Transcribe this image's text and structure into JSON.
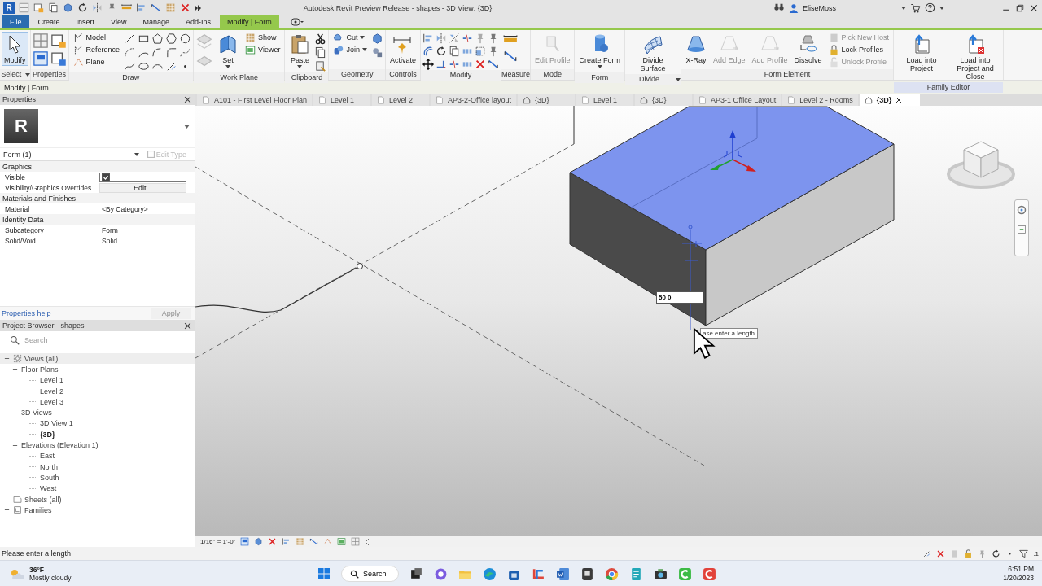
{
  "window": {
    "logo": "R",
    "title": "Autodesk Revit Preview Release - shapes - 3D View: {3D}",
    "user": "EliseMoss"
  },
  "ribbon_tabs": [
    {
      "label": "File",
      "kind": "file",
      "selected": false
    },
    {
      "label": "Create",
      "kind": "tab",
      "selected": false
    },
    {
      "label": "Insert",
      "kind": "tab",
      "selected": false
    },
    {
      "label": "View",
      "kind": "tab",
      "selected": false
    },
    {
      "label": "Manage",
      "kind": "tab",
      "selected": false
    },
    {
      "label": "Add-Ins",
      "kind": "tab",
      "selected": false
    },
    {
      "label": "Modify | Form",
      "kind": "context",
      "selected": true
    }
  ],
  "ribbon_panels": [
    {
      "title": "Select",
      "menu": true,
      "highlighted": false,
      "tools": [
        {
          "kind": "large",
          "label": "Modify",
          "active": true,
          "disabled": false,
          "dropdown": false
        }
      ]
    },
    {
      "title": "Properties",
      "menu": false,
      "highlighted": false,
      "tools": [
        {
          "kind": "propertyicons"
        }
      ]
    },
    {
      "title": "Draw",
      "menu": false,
      "highlighted": false,
      "tools": [
        {
          "kind": "small",
          "label": "Model",
          "active": false,
          "disabled": false,
          "dropdown": false
        },
        {
          "kind": "small",
          "label": "Reference",
          "active": false,
          "disabled": false,
          "dropdown": false
        },
        {
          "kind": "small",
          "label": "Plane",
          "active": false,
          "disabled": false,
          "dropdown": false
        },
        {
          "kind": "drawshapes"
        }
      ]
    },
    {
      "title": "Work Plane",
      "menu": false,
      "highlighted": false,
      "tools": [
        {
          "kind": "planeicons"
        },
        {
          "kind": "large",
          "label": "Set",
          "active": false,
          "disabled": false,
          "dropdown": true
        },
        {
          "kind": "small",
          "label": "Show",
          "active": false,
          "disabled": false,
          "dropdown": false
        },
        {
          "kind": "small",
          "label": "Viewer",
          "active": false,
          "disabled": false,
          "dropdown": false
        }
      ]
    },
    {
      "title": "Clipboard",
      "menu": false,
      "highlighted": false,
      "tools": [
        {
          "kind": "large",
          "label": "Paste",
          "active": false,
          "disabled": false,
          "dropdown": true
        },
        {
          "kind": "clipicons"
        }
      ]
    },
    {
      "title": "Geometry",
      "menu": false,
      "highlighted": false,
      "tools": [
        {
          "kind": "small",
          "label": "Cut",
          "active": false,
          "disabled": false,
          "dropdown": true
        },
        {
          "kind": "small",
          "label": "Join",
          "active": false,
          "disabled": false,
          "dropdown": true
        },
        {
          "kind": "geometryicons"
        }
      ]
    },
    {
      "title": "Controls",
      "menu": false,
      "highlighted": false,
      "tools": [
        {
          "kind": "large",
          "label": "Activate",
          "active": false,
          "disabled": false,
          "dropdown": false
        }
      ]
    },
    {
      "title": "Modify",
      "menu": false,
      "highlighted": false,
      "tools": [
        {
          "kind": "modifyicons"
        }
      ]
    },
    {
      "title": "Measure",
      "menu": false,
      "highlighted": false,
      "tools": [
        {
          "kind": "measureicons"
        }
      ]
    },
    {
      "title": "Mode",
      "menu": false,
      "highlighted": false,
      "tools": [
        {
          "kind": "large",
          "label": "Edit Profile",
          "active": false,
          "disabled": true,
          "dropdown": false
        }
      ]
    },
    {
      "title": "Form",
      "menu": false,
      "highlighted": false,
      "tools": [
        {
          "kind": "large",
          "label": "Create Form",
          "active": false,
          "disabled": false,
          "dropdown": true
        }
      ]
    },
    {
      "title": "Divide",
      "menu": true,
      "highlighted": false,
      "tools": [
        {
          "kind": "large",
          "label": "Divide Surface",
          "active": false,
          "disabled": false,
          "dropdown": false
        }
      ]
    },
    {
      "title": "Form Element",
      "menu": false,
      "highlighted": false,
      "tools": [
        {
          "kind": "large",
          "label": "X-Ray",
          "active": false,
          "disabled": false,
          "dropdown": false
        },
        {
          "kind": "large",
          "label": "Add Edge",
          "active": false,
          "disabled": true,
          "dropdown": false
        },
        {
          "kind": "large",
          "label": "Add Profile",
          "active": false,
          "disabled": true,
          "dropdown": false
        },
        {
          "kind": "large",
          "label": "Dissolve",
          "active": false,
          "disabled": false,
          "dropdown": false
        },
        {
          "kind": "small",
          "label": "Pick New Host",
          "active": false,
          "disabled": true,
          "dropdown": false
        },
        {
          "kind": "small",
          "label": "Lock Profiles",
          "active": false,
          "disabled": false,
          "dropdown": false
        },
        {
          "kind": "small",
          "label": "Unlock Profile",
          "active": false,
          "disabled": true,
          "dropdown": false
        }
      ]
    },
    {
      "title": "Family Editor",
      "menu": false,
      "highlighted": true,
      "tools": [
        {
          "kind": "large",
          "label": "Load into Project",
          "active": false,
          "disabled": false,
          "dropdown": false
        },
        {
          "kind": "large",
          "label": "Load into Project and Close",
          "active": false,
          "disabled": false,
          "dropdown": false
        }
      ]
    }
  ],
  "context_bar": "Modify | Form",
  "properties": {
    "title": "Properties",
    "type_image": "R",
    "type_selector": "Form (1)",
    "edit_type": {
      "label": "Edit Type",
      "disabled": true
    },
    "groups": [
      {
        "name": "Graphics",
        "rows": [
          {
            "kind": "checkbox",
            "label": "Visible",
            "checked": true
          },
          {
            "kind": "button",
            "label": "Visibility/Graphics Overrides",
            "value": "Edit..."
          }
        ]
      },
      {
        "name": "Materials and Finishes",
        "rows": [
          {
            "kind": "text",
            "label": "Material",
            "value": "<By Category>"
          }
        ]
      },
      {
        "name": "Identity Data",
        "rows": [
          {
            "kind": "text",
            "label": "Subcategory",
            "value": "Form"
          },
          {
            "kind": "text",
            "label": "Solid/Void",
            "value": "Solid"
          }
        ]
      }
    ],
    "help_link": "Properties help",
    "apply": {
      "label": "Apply",
      "disabled": true
    }
  },
  "project_browser": {
    "title": "Project Browser - shapes",
    "search_placeholder": "Search",
    "tree": [
      {
        "label": "Views (all)",
        "expanded": true,
        "selected": true,
        "current": false,
        "children": [
          {
            "label": "Floor Plans",
            "expanded": true,
            "selected": false,
            "current": false,
            "children": [
              {
                "label": "Level 1",
                "selected": false,
                "current": false
              },
              {
                "label": "Level 2",
                "selected": false,
                "current": false
              },
              {
                "label": "Level 3",
                "selected": false,
                "current": false
              }
            ]
          },
          {
            "label": "3D Views",
            "expanded": true,
            "selected": false,
            "current": false,
            "children": [
              {
                "label": "3D View 1",
                "selected": false,
                "current": false
              },
              {
                "label": "{3D}",
                "selected": false,
                "current": true
              }
            ]
          },
          {
            "label": "Elevations (Elevation 1)",
            "expanded": true,
            "selected": false,
            "current": false,
            "children": [
              {
                "label": "East",
                "selected": false,
                "current": false
              },
              {
                "label": "North",
                "selected": false,
                "current": false
              },
              {
                "label": "South",
                "selected": false,
                "current": false
              },
              {
                "label": "West",
                "selected": false,
                "current": false
              }
            ]
          }
        ]
      },
      {
        "label": "Sheets (all)",
        "selected": false,
        "current": false
      },
      {
        "label": "Families",
        "expanded": false,
        "selected": false,
        "current": false
      }
    ]
  },
  "view_tabs": [
    {
      "label": "A101 - First Level Floor Plan",
      "kind": "plan",
      "selected": false
    },
    {
      "label": "Level 1",
      "kind": "plan",
      "selected": false
    },
    {
      "label": "Level 2",
      "kind": "plan",
      "selected": false
    },
    {
      "label": "AP3-2-Office layout",
      "kind": "plan",
      "selected": false
    },
    {
      "label": "{3D}",
      "kind": "perspective",
      "selected": false
    },
    {
      "label": "Level 1",
      "kind": "plan",
      "selected": false
    },
    {
      "label": "{3D}",
      "kind": "perspective",
      "selected": false
    },
    {
      "label": "AP3-1 Office Layout",
      "kind": "plan",
      "selected": false
    },
    {
      "label": "Level 2 - Rooms",
      "kind": "plan",
      "selected": false
    },
    {
      "label": "{3D}",
      "kind": "perspective",
      "selected": true
    }
  ],
  "viewport": {
    "length_input": {
      "value": "50 0"
    },
    "tooltip": "ase enter a length"
  },
  "view_control_bar": {
    "scale": "1/16\" = 1'-0\""
  },
  "status_bar": {
    "message": "Please enter a length",
    "filter_count": ":1"
  },
  "taskbar": {
    "weather": {
      "temperature": "36°F",
      "condition": "Mostly cloudy"
    },
    "search": "Search",
    "clock": {
      "time": "6:51 PM",
      "date": "1/20/2023"
    }
  }
}
